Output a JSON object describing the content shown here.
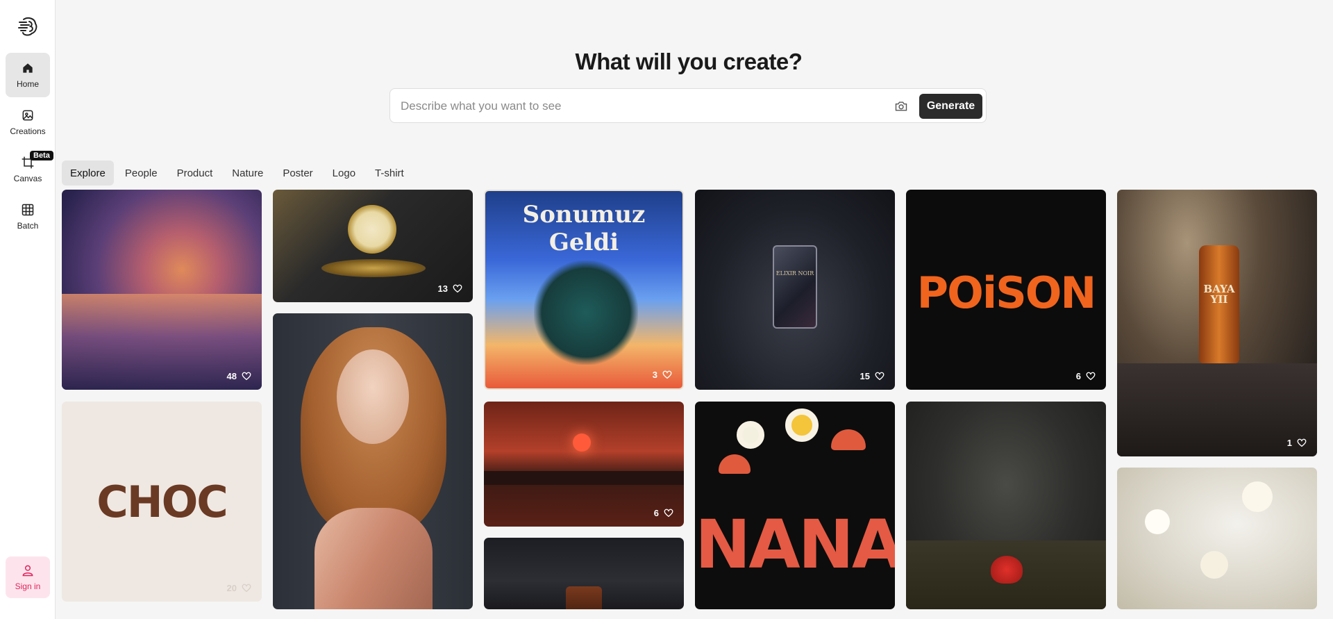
{
  "sidebar": {
    "items": [
      {
        "label": "Home"
      },
      {
        "label": "Creations"
      },
      {
        "label": "Canvas"
      },
      {
        "label": "Batch"
      }
    ],
    "beta_badge": "Beta",
    "signin_label": "Sign in"
  },
  "hero": {
    "title": "What will you create?",
    "search_placeholder": "Describe what you want to see",
    "generate_label": "Generate"
  },
  "tabs": [
    {
      "label": "Explore",
      "active": true
    },
    {
      "label": "People"
    },
    {
      "label": "Product"
    },
    {
      "label": "Nature"
    },
    {
      "label": "Poster"
    },
    {
      "label": "Logo"
    },
    {
      "label": "T-shirt"
    }
  ],
  "gallery": [
    {
      "subject": "purple sunset sky over water",
      "likes": "48"
    },
    {
      "subject": "chocolate logo",
      "text": "CHOC",
      "likes": "20"
    },
    {
      "subject": "golden clock on dark fabric",
      "likes": "13"
    },
    {
      "subject": "red-haired woman in satin dress"
    },
    {
      "subject": "grim reaper poster",
      "text": "Sonumuz Geldi",
      "likes": "3"
    },
    {
      "subject": "red sunset over lake with pier",
      "likes": "6"
    },
    {
      "subject": "incense smoke product"
    },
    {
      "subject": "perfume bottle with black roses",
      "text": "ELIXIR NOIR",
      "likes": "15"
    },
    {
      "subject": "retro flowers t-shirt",
      "text": "NANA"
    },
    {
      "subject": "poison logo",
      "text": "POiSON",
      "likes": "6"
    },
    {
      "subject": "red poppy in misty field"
    },
    {
      "subject": "whiskey bottle on coal",
      "text": "BAYAYII",
      "likes": "1"
    },
    {
      "subject": "white blossoms"
    }
  ]
}
